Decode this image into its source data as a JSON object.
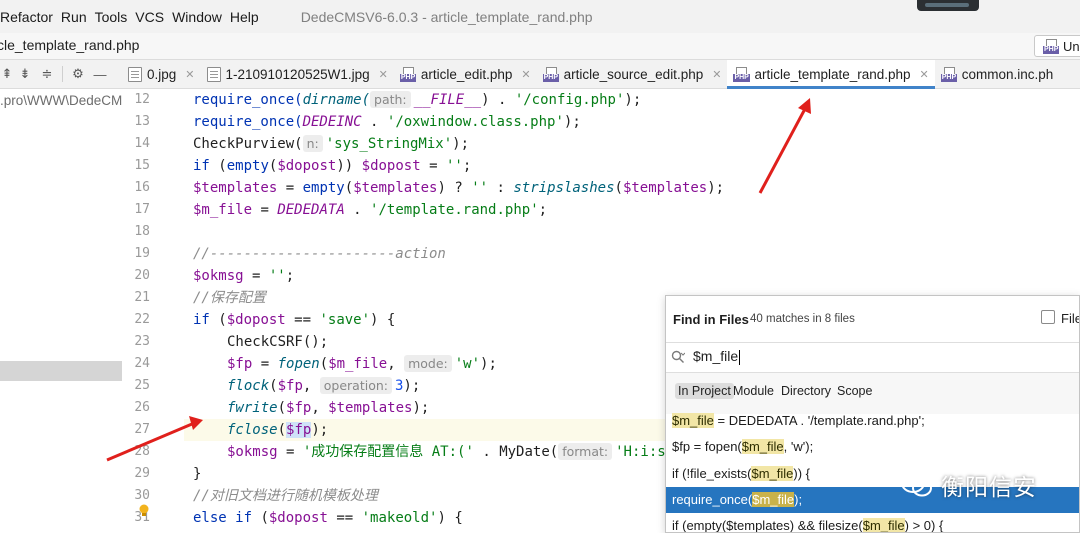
{
  "menubar": {
    "items": [
      "Refactor",
      "Run",
      "Tools",
      "VCS",
      "Window",
      "Help"
    ],
    "window_title": "DedeCMSV6-6.0.3 - article_template_rand.php"
  },
  "navbar": {
    "file": "cle_template_rand.php",
    "php_button_label": "Un"
  },
  "project": {
    "path": ".pro\\WWW\\DedeCMS"
  },
  "tabs": [
    {
      "label": "0.jpg",
      "icon": "image-file-icon",
      "active": false
    },
    {
      "label": "1-210910120525W1.jpg",
      "icon": "image-file-icon",
      "active": false
    },
    {
      "label": "article_edit.php",
      "icon": "php-file-icon",
      "active": false
    },
    {
      "label": "article_source_edit.php",
      "icon": "php-file-icon",
      "active": false
    },
    {
      "label": "article_template_rand.php",
      "icon": "php-file-icon",
      "active": true
    },
    {
      "label": "common.inc.ph",
      "icon": "php-file-icon",
      "active": false
    }
  ],
  "editor": {
    "line_numbers": [
      "12",
      "13",
      "14",
      "15",
      "16",
      "17",
      "18",
      "19",
      "20",
      "21",
      "22",
      "23",
      "24",
      "25",
      "26",
      "27",
      "28",
      "29",
      "30",
      "31"
    ],
    "hints": {
      "path": "path:",
      "n": "n:",
      "mode": "mode:",
      "operation": "operation:",
      "format": "format:"
    },
    "code": {
      "l12_a": "require_once(",
      "l12_b": "dirname(",
      "l12_c": "__FILE__",
      "l12_d": ") . ",
      "l12_e": "'/config.php'",
      "l12_f": ");",
      "l13_a": "require_once(",
      "l13_b": "DEDEINC",
      "l13_c": " . ",
      "l13_d": "'/oxwindow.class.php'",
      "l13_e": ");",
      "l14_a": "CheckPurview(",
      "l14_b": "'sys_StringMix'",
      "l14_c": ");",
      "l15_a": "if ",
      "l15_b": "(",
      "l15_c": "empty",
      "l15_d": "(",
      "l15_e": "$dopost",
      "l15_f": ")) ",
      "l15_g": "$dopost",
      "l15_h": " = ",
      "l15_i": "''",
      "l15_j": ";",
      "l16_a": "$templates",
      "l16_b": " = ",
      "l16_c": "empty",
      "l16_d": "(",
      "l16_e": "$templates",
      "l16_f": ") ? ",
      "l16_g": "''",
      "l16_h": " : ",
      "l16_i": "stripslashes",
      "l16_j": "(",
      "l16_k": "$templates",
      "l16_l": ");",
      "l17_a": "$m_file",
      "l17_b": " = ",
      "l17_c": "DEDEDATA",
      "l17_d": " . ",
      "l17_e": "'/template.rand.php'",
      "l17_f": ";",
      "l19": "//----------------------action",
      "l20_a": "$okmsg",
      "l20_b": " = ",
      "l20_c": "''",
      "l20_d": ";",
      "l21": "//保存配置",
      "l22_a": "if ",
      "l22_b": "(",
      "l22_c": "$dopost",
      "l22_d": " == ",
      "l22_e": "'save'",
      "l22_f": ") {",
      "l23": "CheckCSRF();",
      "l24_a": "$fp",
      "l24_b": " = ",
      "l24_c": "fopen",
      "l24_d": "(",
      "l24_e": "$m_file",
      "l24_f": ", ",
      "l24_g": "'w'",
      "l24_h": ");",
      "l25_a": "flock",
      "l25_b": "(",
      "l25_c": "$fp",
      "l25_d": ", ",
      "l25_e": "3",
      "l25_f": ");",
      "l26_a": "fwrite",
      "l26_b": "(",
      "l26_c": "$fp",
      "l26_d": ", ",
      "l26_e": "$templates",
      "l26_f": ");",
      "l27_a": "fclose",
      "l27_b": "(",
      "l27_c": "$fp",
      "l27_d": ");",
      "l28_a": "$okmsg",
      "l28_b": " = ",
      "l28_c": "'成功保存配置信息 AT:('",
      "l28_d": " . ",
      "l28_e": "MyDate(",
      "l28_f": "'H:i:s",
      "l29": "}",
      "l30": "//对旧文档进行随机模板处理",
      "l31_a": "else if ",
      "l31_b": "(",
      "l31_c": "$dopost",
      "l31_d": " == ",
      "l31_e": "'makeold'",
      "l31_f": ") {"
    }
  },
  "find_in_files": {
    "title": "Find in Files",
    "count": "40 matches in 8 files",
    "file_mask_label": "File",
    "query": "$m_file",
    "scopes": [
      {
        "label": "In Project",
        "active": true
      },
      {
        "label": "Module",
        "active": false
      },
      {
        "label": "Directory",
        "active": false
      },
      {
        "label": "Scope",
        "active": false
      }
    ],
    "results": [
      {
        "before": "",
        "match": "$m_file",
        "after": " = DEDEDATA . '/template.rand.php';",
        "selected": false
      },
      {
        "before": "$fp = fopen(",
        "match": "$m_file",
        "after": ", 'w');",
        "selected": false
      },
      {
        "before": "if (!file_exists(",
        "match": "$m_file",
        "after": ")) {",
        "selected": false
      },
      {
        "before": "require_once(",
        "match": "$m_file",
        "after": ");",
        "selected": true
      },
      {
        "before": "if (empty($templates) && filesize(",
        "match": "$m_file",
        "after": ") > 0) {",
        "selected": false
      }
    ]
  },
  "watermark": {
    "text": "衡阳信安"
  },
  "colors": {
    "accent": "#4083c9",
    "selection": "#2675bf",
    "annotation_arrow": "#e0201c"
  }
}
